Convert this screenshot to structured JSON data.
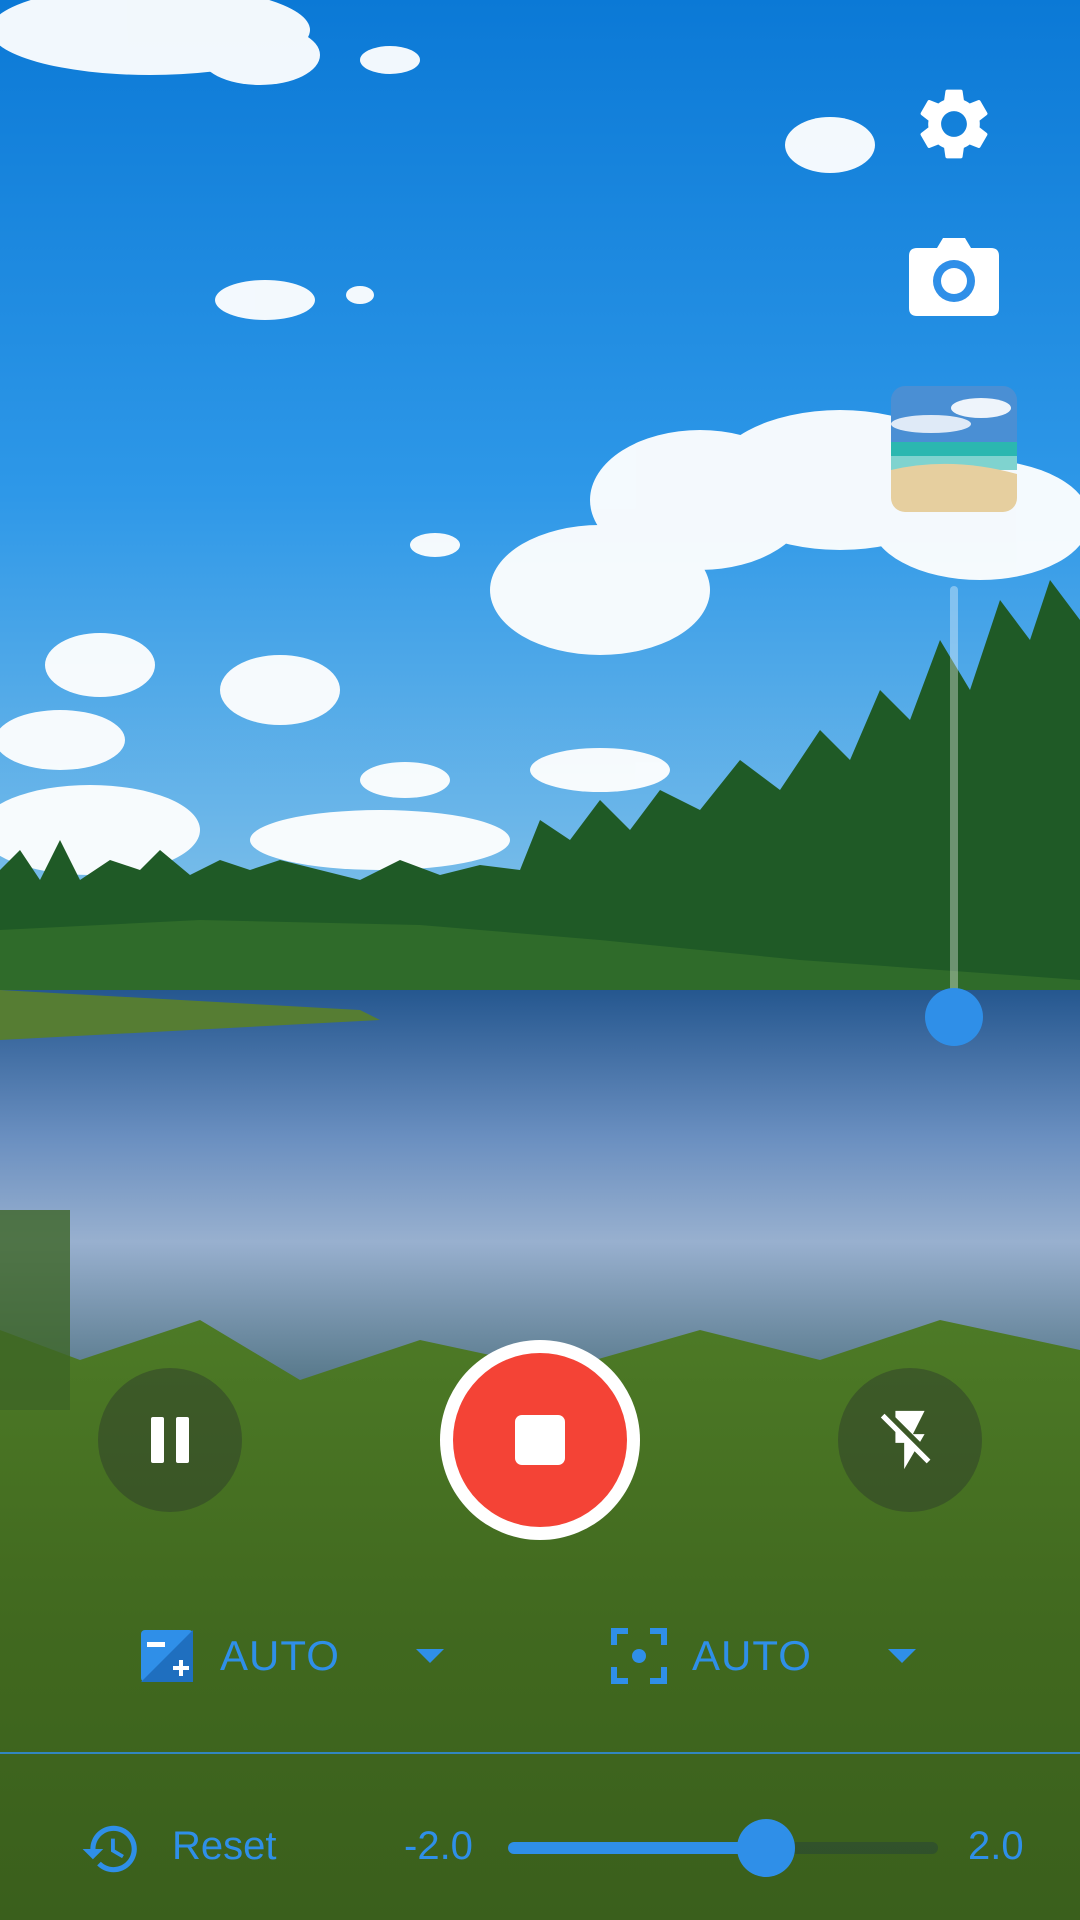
{
  "viewfinder": {
    "scene_description_icon": "landscape-preview"
  },
  "top_controls": {
    "settings_icon": "gear-icon",
    "camera_icon": "camera-icon",
    "gallery_thumbnail_icon": "gallery-thumbnail"
  },
  "zoom": {
    "level": 0.0
  },
  "record_controls": {
    "pause_icon": "pause-icon",
    "record_icon": "stop-record-icon",
    "flash_icon": "flash-off-icon"
  },
  "mode_selectors": {
    "exposure": {
      "label": "AUTO",
      "icon": "exposure-icon"
    },
    "focus": {
      "label": "AUTO",
      "icon": "focus-icon"
    }
  },
  "exposure_compensation": {
    "reset_label": "Reset",
    "min_label": "-2.0",
    "max_label": "2.0",
    "min": -2.0,
    "max": 2.0,
    "value": 0.4
  },
  "colors": {
    "accent": "#2f8fe8",
    "record": "#f44336",
    "white": "#ffffff"
  }
}
